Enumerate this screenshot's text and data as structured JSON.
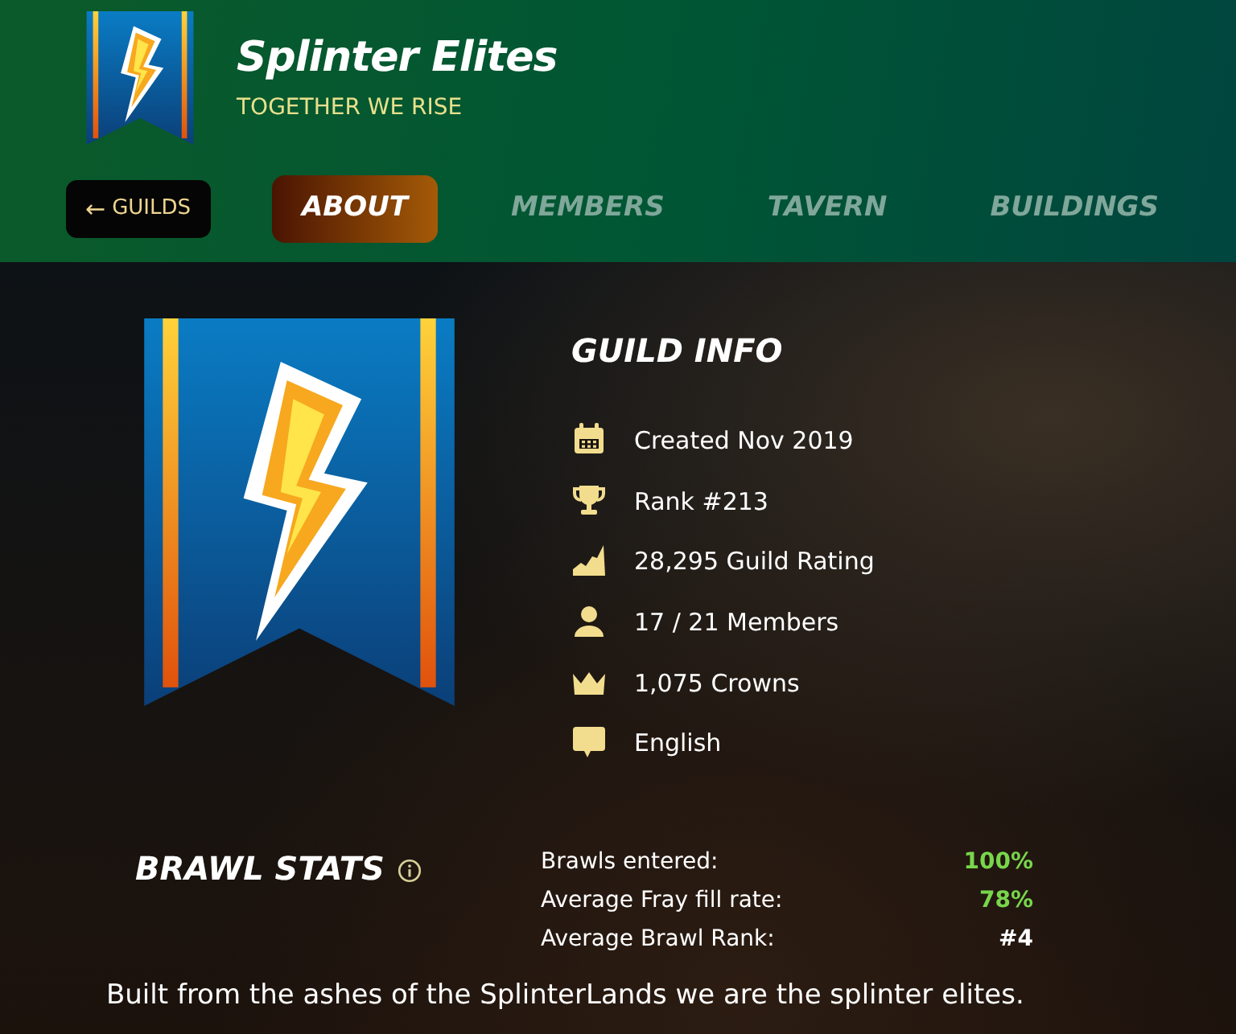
{
  "guild": {
    "name": "Splinter Elites",
    "motto": "TOGETHER WE RISE"
  },
  "back_button": {
    "icon": "←",
    "label": "GUILDS"
  },
  "tabs": [
    {
      "label": "ABOUT",
      "selected": true
    },
    {
      "label": "MEMBERS",
      "selected": false
    },
    {
      "label": "TAVERN",
      "selected": false
    },
    {
      "label": "BUILDINGS",
      "selected": false
    }
  ],
  "guild_info": {
    "title": "GUILD INFO",
    "items": [
      {
        "kind": "calendar",
        "text": "Created Nov 2019"
      },
      {
        "kind": "trophy",
        "text": "Rank #213"
      },
      {
        "kind": "rating",
        "text": "28,295 Guild Rating"
      },
      {
        "kind": "members",
        "text": "17 / 21 Members"
      },
      {
        "kind": "crown",
        "text": "1,075 Crowns"
      },
      {
        "kind": "language",
        "text": "English"
      }
    ]
  },
  "brawl_stats": {
    "title": "BRAWL STATS",
    "stats": [
      {
        "label": "Brawls entered:",
        "value": "100%",
        "color": "#78d64b"
      },
      {
        "label": "Average Fray fill rate:",
        "value": "78%",
        "color": "#78d64b"
      },
      {
        "label": "Average Brawl Rank:",
        "value": "#4",
        "color": "#ffffff"
      }
    ]
  },
  "description": "Built from the ashes of the SplinterLands we are the splinter elites."
}
